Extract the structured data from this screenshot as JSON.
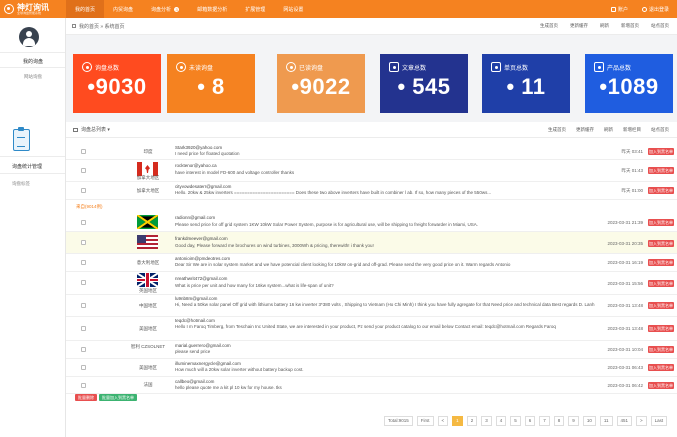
{
  "brand": {
    "name": "神灯询讯",
    "sub": "全球询盘智能系统"
  },
  "nav": [
    {
      "label": "我的首页",
      "active": true
    },
    {
      "label": "内贸询盘",
      "active": false
    },
    {
      "label": "询盘分析",
      "active": false,
      "badge": "3"
    },
    {
      "label": "邮箱数据分析",
      "active": false
    },
    {
      "label": "扩展管理",
      "active": false
    },
    {
      "label": "网站设置",
      "active": false
    }
  ],
  "top_right": {
    "account": "账户",
    "logout": "退出登录"
  },
  "sidebar": {
    "section1_title": "我的询盘",
    "section1_item": "网站询盘",
    "section2_title": "询盘统计管理",
    "section2_item": "询盘标签"
  },
  "breadcrumb": {
    "text": "我的首页 » 系统首页",
    "actions": [
      "生成首页",
      "更新缓存",
      "刷新",
      "新增首页",
      "站点首页"
    ]
  },
  "stats": [
    {
      "label": "询盘总数",
      "value": "•9030",
      "color": "#ff4b1f"
    },
    {
      "label": "未读询盘",
      "value": "• 8",
      "color": "#f58220"
    },
    {
      "label": "已读询盘",
      "value": "•9022",
      "color": "#ef9a4f"
    },
    {
      "label": "文章总数",
      "value": "• 545",
      "color": "#23338f"
    },
    {
      "label": "单页总数",
      "value": "• 11",
      "color": "#1f3fa8"
    },
    {
      "label": "产品总数",
      "value": "•1089",
      "color": "#1f5de0"
    }
  ],
  "panel": {
    "title": "询盘总列表 ▾",
    "actions": [
      "生成首页",
      "更新缓存",
      "刷新",
      "新增栏目",
      "站点首页"
    ]
  },
  "section_label": "来自(9014例)",
  "rows": [
    {
      "region": "印度",
      "email": "Stark3920@yahoo.com",
      "message": "I need price for floated quotation",
      "time": "昨天 03:41",
      "btn": "加入到黑名单"
    },
    {
      "region": "加拿大地区",
      "email": "rocktenor@yahoo.ca",
      "message": "have interest in model FD-600 and voltage controller thanks",
      "time": "昨天 01:43",
      "btn": "加入到黑名单"
    },
    {
      "region": "加拿大地区",
      "email": "cityvowdesaterr@gmail.com",
      "message": "Hello. 20kw & 25kw inverters ======================= Does these two above inverters have built in combiner l ab. If so, how many pieces of the 550ws...",
      "time": "昨天 01:00",
      "btn": "加入到黑名单"
    },
    {
      "region": "",
      "email": "radionn@gmail.com",
      "message": "Please send price for off grid system 1KW 10kW Solar Power System, purpose is for agricultural use, will be shipping to freight forwarder in Miami, USA.",
      "time": "2023-03-31 21:39",
      "btn": "加入到黑名单"
    },
    {
      "region": "",
      "email": "frankdmeever@gmail.com",
      "message": "Good day, Please forward me brochures on wind turbines, 3000Wh & pricing, therewith! i thank you!",
      "time": "2023-03-31 20:35",
      "btn": "加入到黑名单"
    },
    {
      "region": "意大利地区",
      "email": "antonioim@pmdeotres.com",
      "message": "Dear Sir We are in solar system market and we have potencial client looking for 10kW on-grid and off-grad. Please send the very good price on it. Warm regards Antonio",
      "time": "2023-03-31 16:19",
      "btn": "加入到黑名单"
    },
    {
      "region": "英国地区",
      "email": "nreathwrit472@gmail.com",
      "message": "What is price per unit and how many for 16kw system...what is life-span of unit?",
      "time": "2023-03-31 15:56",
      "btn": "加入到黑名单"
    },
    {
      "region": "中国地区",
      "email": "lu9nb8m@gmail.com",
      "message": "Hi, Need a 50kw solar panel Off grid with lithiums battery 16 kw inverter 3*380 volts , Shipping to Vietnam (Ho Chi Minh) I think you have fully agregate for that Need price and technical data Best regards D. Lanh",
      "time": "2023-03-31 13:48",
      "btn": "加入到黑名单"
    },
    {
      "region": "美国地区",
      "email": "teqdc@hotmail.com",
      "message": "Hello I m Faroq Timberg, from Teschain Inc United State, we are interested in your product, Pz send your product catalog to our email below Contact email: teqdc@hotmail.com Regards Faroq",
      "time": "2023-03-31 13:48",
      "btn": "加入到黑名单"
    },
    {
      "region": "智利 CZSOLNET",
      "email": "marial.guerrero@gmail.com",
      "message": "please send price",
      "time": "2023-03-31 10:04",
      "btn": "加入到黑名单"
    },
    {
      "region": "美国地区",
      "email": "illuminemaxnergycle@gmail.com",
      "message": "How much will a 20kw solar inverter without battery backup cost.",
      "time": "2023-03-31 06:43",
      "btn": "加入到黑名单"
    },
    {
      "region": "法国",
      "email": "callbeo@gmail.com",
      "message": "hello please quote me a kit pl 10 kw for my house. tks",
      "time": "2023-03-31 06:42",
      "btn": "加入到黑名单"
    }
  ],
  "bottom_buttons": [
    {
      "label": "批量删除",
      "color": "#e84f4f"
    },
    {
      "label": "批量加入到黑名单",
      "color": "#3cb371"
    }
  ],
  "pagination": {
    "total": "Total:9015",
    "items": [
      "First",
      "<",
      "1",
      "2",
      "3",
      "4",
      "5",
      "6",
      "7",
      "8",
      "9",
      "10",
      "11",
      "451",
      ">",
      "Last"
    ],
    "active": "1"
  }
}
